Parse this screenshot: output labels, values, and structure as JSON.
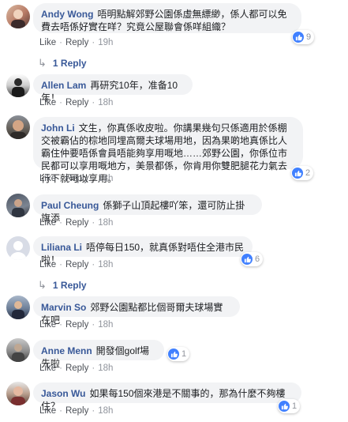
{
  "actions": {
    "like": "Like",
    "reply": "Reply",
    "separator": "·"
  },
  "colors": {
    "name": "#385898",
    "bubble": "#f2f3f5",
    "like_blue": "#4080ff"
  },
  "comments": [
    {
      "author": "Andy Wong",
      "text": "唔明點解郊野公園係虛無縹緲，係人都可以免費去唔係好實在咩？究竟公屋聯會係咩組織？",
      "time": "19h",
      "reactions": "9",
      "replies": "1 Reply"
    },
    {
      "author": "Allen Lam",
      "text": "再研究10年，准备10年！",
      "time": "18h"
    },
    {
      "author": "John Li",
      "text": "文生，你真係收皮啦。你講果幾句只係適用於係棚交被霸佔的棕地同埋高爾夫球場用地，因為果啲地真係比人霸住仲要唔係會員唔能夠享用嘅地……郊野公園，你係位市民都可以享用嘅地方，美景都係，你肯用你雙肥腿花力氣去行下就可以享用。",
      "time": "18h",
      "reactions": "2"
    },
    {
      "author": "Paul Cheung",
      "text": "係獅子山頂起樓吖笨，還可防止掛旗添",
      "time": "18h"
    },
    {
      "author": "Liliana Li",
      "text": "唔停每日150，就真係對唔住全港市民啦！",
      "time": "18h",
      "reactions": "6",
      "replies": "1 Reply"
    },
    {
      "author": "Marvin So",
      "text": "郊野公園點都比個哥爾夫球場實在吧",
      "time": "18h"
    },
    {
      "author": "Anne Menn",
      "text": "開發個golf場先啦",
      "time": "18h",
      "reactions": "1"
    },
    {
      "author": "Jason Wu",
      "text": "如果每150個來港是不關事的，那為什麼不夠樓住？",
      "time": "18h",
      "reactions": "1"
    }
  ]
}
